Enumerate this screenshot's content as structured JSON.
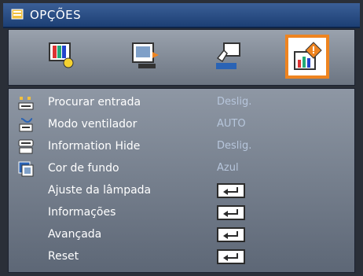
{
  "window": {
    "title": "OPÇÕES"
  },
  "tabs": [
    {
      "name": "image-icon"
    },
    {
      "name": "display-icon"
    },
    {
      "name": "setup-icon"
    },
    {
      "name": "options-icon",
      "selected": true
    }
  ],
  "menu": {
    "items": [
      {
        "label": "Procurar entrada",
        "value": "Deslig.",
        "icon": "source-search-icon"
      },
      {
        "label": "Modo ventilador",
        "value": "AUTO",
        "icon": "fan-mode-icon"
      },
      {
        "label": "Information Hide",
        "value": "Deslig.",
        "icon": "info-hide-icon"
      },
      {
        "label": "Cor de fundo",
        "value": "Azul",
        "icon": "background-color-icon"
      },
      {
        "label": "Ajuste da lâmpada",
        "control": "enter-key-icon"
      },
      {
        "label": "Informações",
        "control": "enter-key-icon"
      },
      {
        "label": "Avançada",
        "control": "enter-key-icon"
      },
      {
        "label": "Reset",
        "control": "enter-key-icon"
      }
    ]
  },
  "colors": {
    "title_bar": "#1c3f74",
    "selection": "#ee8420",
    "value_text": "#b7c6dc"
  }
}
